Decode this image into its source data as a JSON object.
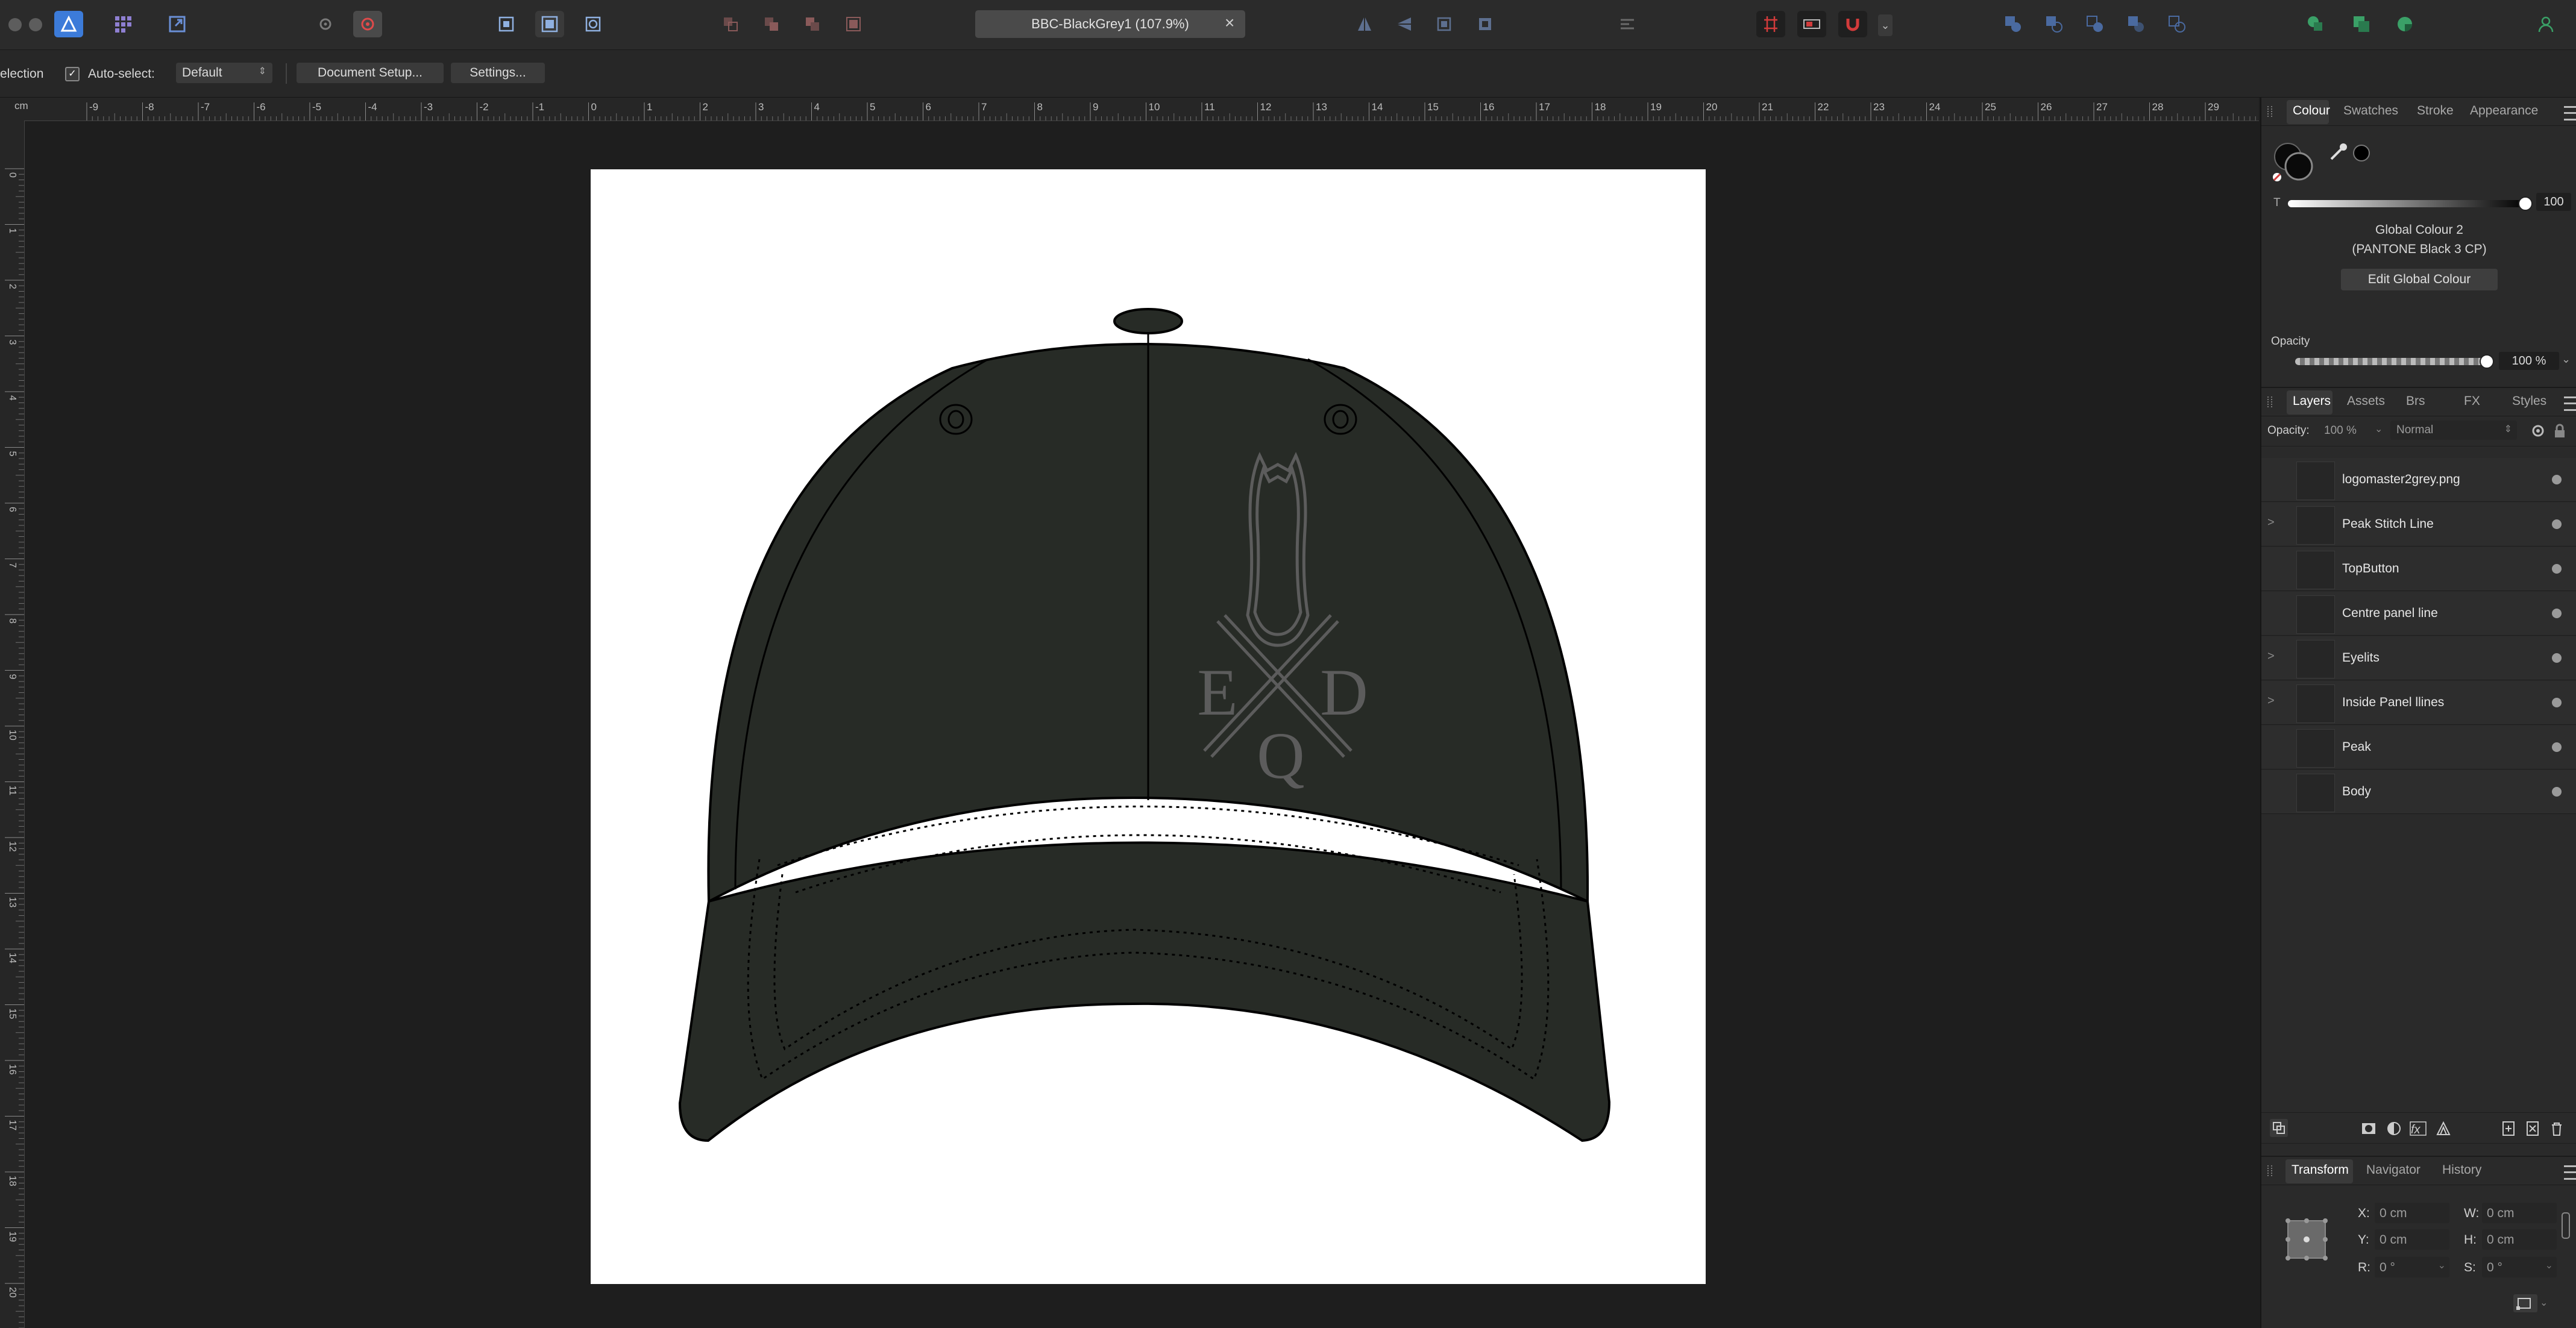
{
  "toolbar": {
    "document_title": "BBC-BlackGrey1 (107.9%)",
    "close_glyph": "×"
  },
  "context_bar": {
    "tool_name": "election",
    "autoselect_label": "Auto-select:",
    "autoselect_value": "Default",
    "document_setup_label": "Document Setup...",
    "settings_label": "Settings..."
  },
  "rulers": {
    "unit": "cm",
    "top_labels": [
      "-9",
      "-8",
      "-7",
      "-6",
      "-5",
      "-4",
      "-3",
      "-2",
      "-1",
      "0",
      "1",
      "2",
      "3",
      "4",
      "5",
      "6",
      "7",
      "8",
      "9",
      "10",
      "11",
      "12",
      "13",
      "14",
      "15",
      "16",
      "17",
      "18",
      "19",
      "20",
      "21",
      "22",
      "23",
      "24",
      "25",
      "26",
      "27",
      "28",
      "29"
    ],
    "left_labels": [
      "0",
      "1",
      "2",
      "3",
      "4",
      "5",
      "6",
      "7",
      "8",
      "9",
      "10",
      "11",
      "12",
      "13",
      "14",
      "15",
      "16",
      "17",
      "18",
      "19",
      "20"
    ]
  },
  "artwork": {
    "logo_letters": [
      "E",
      "D",
      "Q"
    ]
  },
  "colour_panel": {
    "tabs": [
      "Colour",
      "Swatches",
      "Stroke",
      "Appearance"
    ],
    "active_tab": "Colour",
    "tint_label": "T",
    "tint_value": "100",
    "colour_name": "Global Colour 2",
    "colour_spec": "(PANTONE Black 3 CP)",
    "edit_button": "Edit Global Colour",
    "opacity_label": "Opacity",
    "opacity_value": "100 %"
  },
  "layers_panel": {
    "tabs": [
      "Layers",
      "Assets",
      "Brs",
      "FX",
      "Styles"
    ],
    "active_tab": "Layers",
    "opacity_label": "Opacity:",
    "opacity_value": "100 %",
    "blend_mode": "Normal",
    "layers": [
      {
        "name": "logomaster2grey.png",
        "expander": ""
      },
      {
        "name": "Peak Stitch Line",
        "expander": ">"
      },
      {
        "name": "TopButton",
        "expander": ""
      },
      {
        "name": "Centre panel line",
        "expander": ""
      },
      {
        "name": "Eyelits",
        "expander": ">"
      },
      {
        "name": "Inside Panel llines",
        "expander": ">"
      },
      {
        "name": "Peak",
        "expander": ""
      },
      {
        "name": "Body",
        "expander": ""
      }
    ]
  },
  "transform_panel": {
    "tabs": [
      "Transform",
      "Navigator",
      "History"
    ],
    "active_tab": "Transform",
    "x_label": "X:",
    "x_value": "0 cm",
    "y_label": "Y:",
    "y_value": "0 cm",
    "w_label": "W:",
    "w_value": "0 cm",
    "h_label": "H:",
    "h_value": "0 cm",
    "r_label": "R:",
    "r_value": "0 °",
    "s_label": "S:",
    "s_value": "0 °"
  },
  "colors": {
    "cap_fill": "#272b26",
    "logo_stroke": "#5c5c5c",
    "accent_blue": "#3c7bd9",
    "red_icon": "#d23b3b",
    "green_icon": "#3aa067"
  }
}
